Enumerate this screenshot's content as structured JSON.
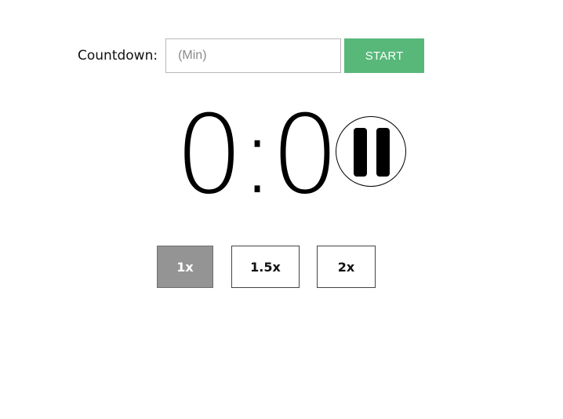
{
  "countdown": {
    "label": "Countdown:",
    "input_value": "",
    "input_placeholder": "(Min)",
    "start_label": "START",
    "start_color": "#57b87a",
    "start_text_color": "#ffffff"
  },
  "timer": {
    "display": "0:0",
    "control_icon": "pause-icon"
  },
  "speed": {
    "options": [
      {
        "label": "1x",
        "active": true
      },
      {
        "label": "1.5x",
        "active": false
      },
      {
        "label": "2x",
        "active": false
      }
    ],
    "active_color": "#949494"
  }
}
